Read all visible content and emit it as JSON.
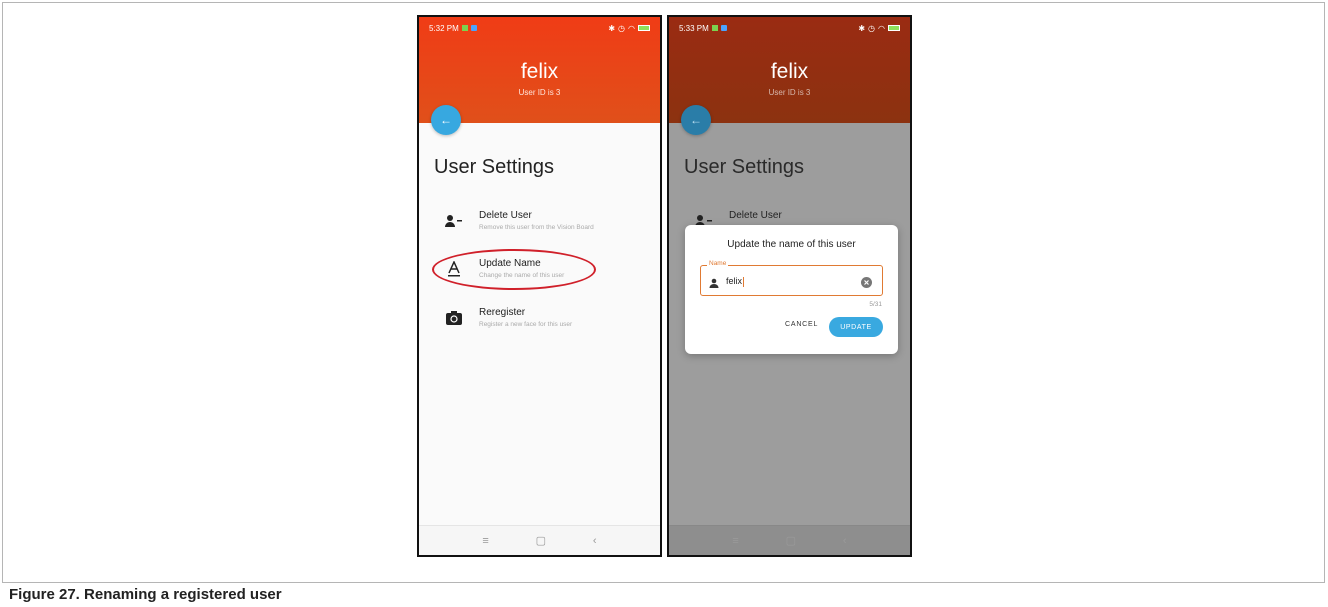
{
  "caption": "Figure 27.  Renaming a registered user",
  "left_phone": {
    "status_time": "5:32 PM",
    "user_name": "felix",
    "user_id_text": "User ID is 3",
    "section_title": "User Settings",
    "settings": [
      {
        "title": "Delete User",
        "subtitle": "Remove this user from the Vision Board",
        "icon": "remove-person-icon"
      },
      {
        "title": "Update Name",
        "subtitle": "Change the name of this user",
        "icon": "text-format-icon"
      },
      {
        "title": "Reregister",
        "subtitle": "Register a new face for this user",
        "icon": "camera-switch-icon"
      }
    ],
    "highlight_color": "#d0202a"
  },
  "right_phone": {
    "status_time": "5:33 PM",
    "user_name": "felix",
    "user_id_text": "User ID is 3",
    "section_title": "User Settings",
    "partial_setting": "Delete User",
    "dialog": {
      "title": "Update the name of this user",
      "field_label": "Name",
      "field_value": "felix",
      "counter": "5/31",
      "cancel_label": "CANCEL",
      "update_label": "UPDATE"
    }
  },
  "colors": {
    "header_red": "#f03c16",
    "accent_blue": "#37a8e0",
    "field_orange": "#e07a33"
  }
}
